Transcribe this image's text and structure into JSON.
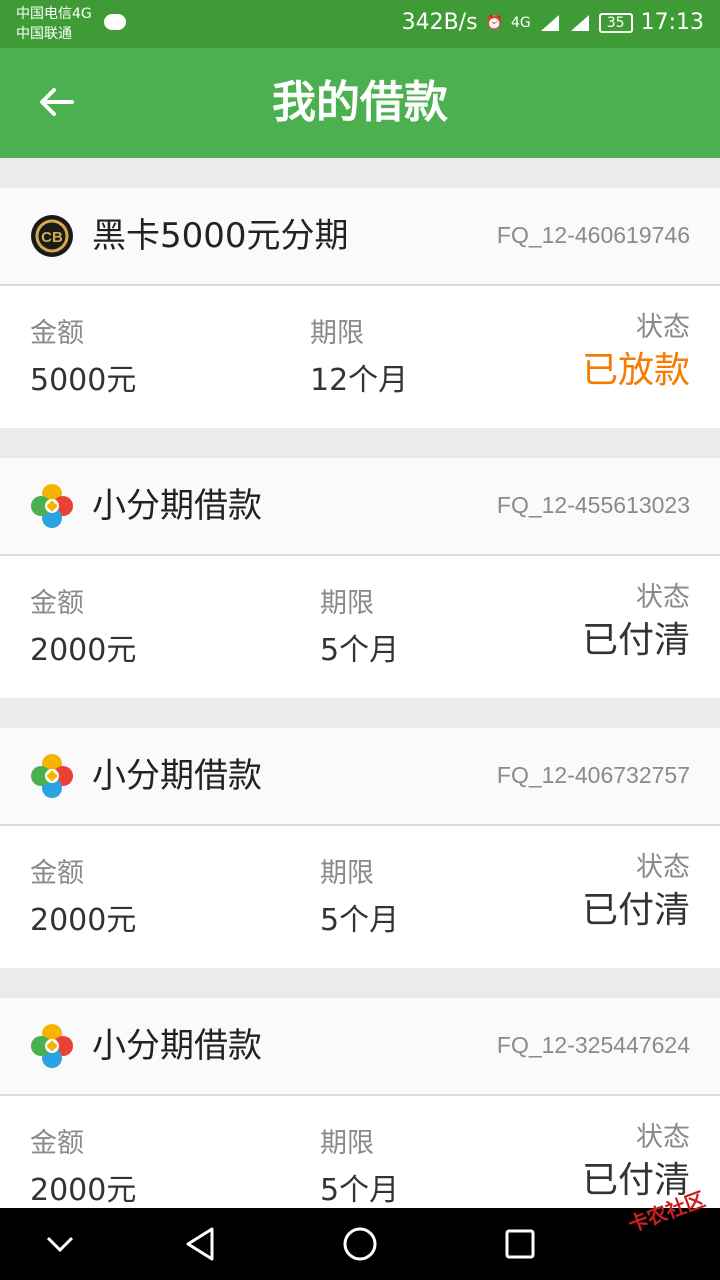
{
  "status_bar": {
    "carrier1": "中国电信4G",
    "carrier2": "中国联通",
    "speed": "342B/s",
    "network": "4G",
    "battery": "35",
    "time": "17:13"
  },
  "header": {
    "title": "我的借款",
    "back_icon": "arrow-left-icon"
  },
  "labels": {
    "amount": "金额",
    "term": "期限",
    "status": "状态"
  },
  "loans": [
    {
      "name": "黑卡5000元分期",
      "id": "FQ_12-460619746",
      "amount": "5000元",
      "term": "12个月",
      "status": "已放款",
      "status_color": "#f57c00",
      "logo": "black-card-logo"
    },
    {
      "name": "小分期借款",
      "id": "FQ_12-455613023",
      "amount": "2000元",
      "term": "5个月",
      "status": "已付清",
      "status_color": "#333333",
      "logo": "colorful-flower-logo"
    },
    {
      "name": "小分期借款",
      "id": "FQ_12-406732757",
      "amount": "2000元",
      "term": "5个月",
      "status": "已付清",
      "status_color": "#333333",
      "logo": "colorful-flower-logo"
    },
    {
      "name": "小分期借款",
      "id": "FQ_12-325447624",
      "amount": "2000元",
      "term": "5个月",
      "status": "已付清",
      "status_color": "#333333",
      "logo": "colorful-flower-logo"
    }
  ],
  "colors": {
    "header": "#4caf50",
    "status_bar": "#3f9b36",
    "released": "#f57c00"
  },
  "watermark": "卡农社区"
}
